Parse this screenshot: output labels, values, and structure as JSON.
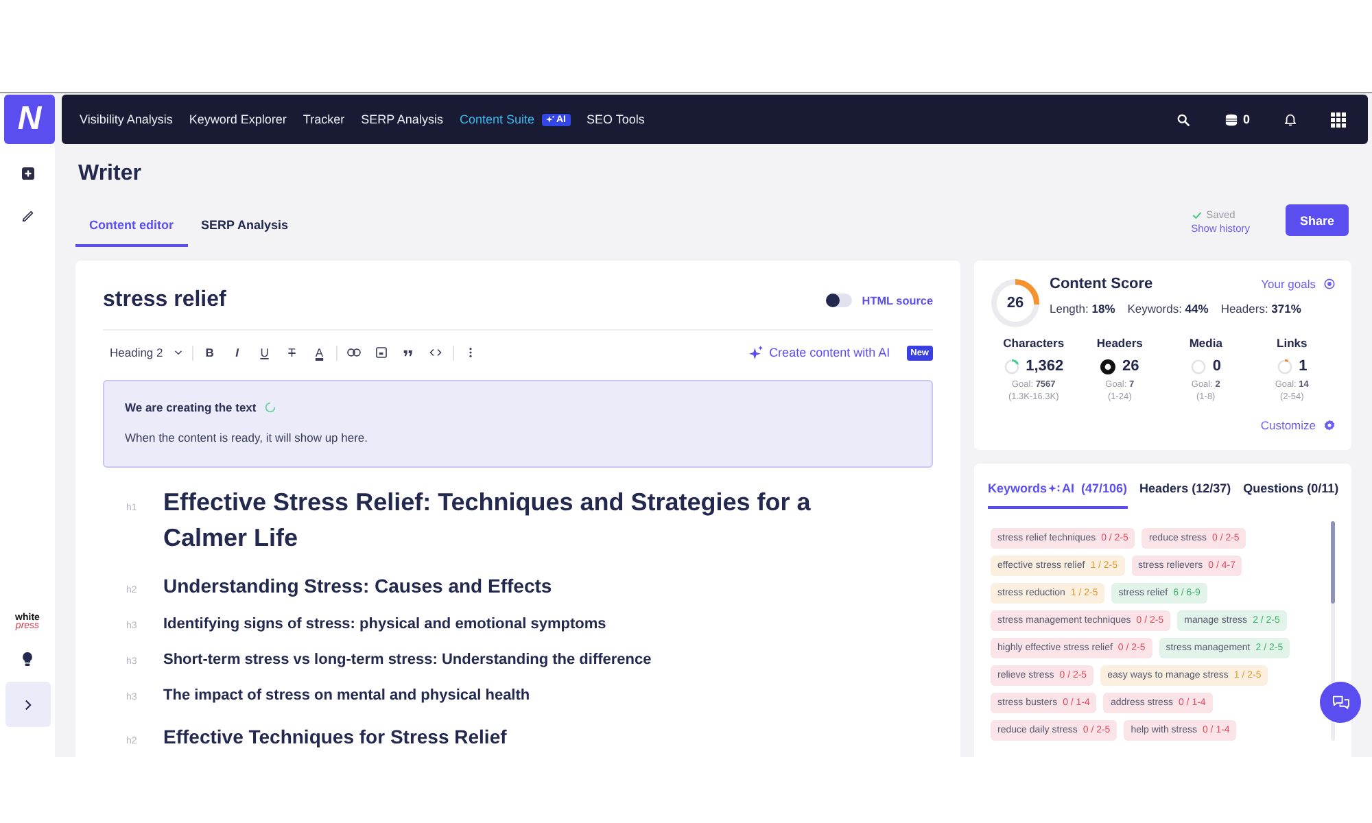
{
  "logo": {
    "text": "N"
  },
  "nav": {
    "items": [
      {
        "label": "Visibility Analysis",
        "selected": false
      },
      {
        "label": "Keyword Explorer",
        "selected": false
      },
      {
        "label": "Tracker",
        "selected": false
      },
      {
        "label": "SERP Analysis",
        "selected": false
      },
      {
        "label": "Content Suite",
        "selected": true,
        "badge": "AI"
      },
      {
        "label": "SEO Tools",
        "selected": false
      }
    ],
    "credits": "0"
  },
  "sidebar": {
    "brand": {
      "line_1": "white",
      "line_2": "press"
    }
  },
  "page": {
    "title": "Writer",
    "tabs": [
      {
        "label": "Content editor",
        "selected": true
      },
      {
        "label": "SERP Analysis",
        "selected": false
      }
    ],
    "save_status": "Saved",
    "history_link": "Show history",
    "share_button": "Share"
  },
  "editor": {
    "title": "stress relief",
    "html_source": {
      "label": "HTML source",
      "on": false
    },
    "toolbar": {
      "block_style": "Heading 2",
      "format_buttons": [
        {
          "kind": "bold",
          "glyph": "B"
        },
        {
          "kind": "italic",
          "glyph": "I"
        },
        {
          "kind": "underline",
          "glyph": "U"
        },
        {
          "kind": "strike",
          "glyph": "T"
        },
        {
          "kind": "color",
          "glyph": "A"
        }
      ],
      "ai_button": "Create content with AI",
      "new_label": "New"
    },
    "notice": {
      "title": "We are creating the text",
      "text": "When the content is ready, it will show up here."
    },
    "outline": [
      {
        "kind": "h1",
        "tag": "h1",
        "text": "Effective Stress Relief: Techniques and Strategies for a Calmer Life"
      },
      {
        "kind": "h2",
        "tag": "h2",
        "text": "Understanding Stress: Causes and Effects"
      },
      {
        "kind": "h3",
        "tag": "h3",
        "text": "Identifying signs of stress: physical and emotional symptoms"
      },
      {
        "kind": "h3",
        "tag": "h3",
        "text": "Short-term stress vs long-term stress: Understanding the difference"
      },
      {
        "kind": "h3",
        "tag": "h3",
        "text": "The impact of stress on mental and physical health"
      },
      {
        "kind": "h2",
        "tag": "h2",
        "text": "Effective Techniques for Stress Relief"
      }
    ]
  },
  "score": {
    "value": "26",
    "level": 0.26,
    "title": "Content Score",
    "goals_link": "Your goals",
    "breakdown": [
      {
        "label": "Length:",
        "value": "18%"
      },
      {
        "label": "Keywords:",
        "value": "44%"
      },
      {
        "label": "Headers:",
        "value": "371%"
      }
    ],
    "metrics": [
      {
        "label": "Characters",
        "value": "1,362",
        "level": 0.18,
        "color": "#3ccf8e",
        "goal": "Goal: **7567**",
        "range": "(1.3K-16.3K)"
      },
      {
        "label": "Headers",
        "value": "26",
        "level": 1,
        "color": "#111111",
        "goal": "Goal: **7**",
        "range": "(1-24)"
      },
      {
        "label": "Media",
        "value": "0",
        "level": 0,
        "goal": "Goal: **2**",
        "range": "(1-8)"
      },
      {
        "label": "Links",
        "value": "1",
        "level": 0.08,
        "color": "#f08a24",
        "goal": "Goal: **14**",
        "range": "(2-54)"
      }
    ],
    "customize_link": "Customize"
  },
  "keywords_panel": {
    "tabs": [
      {
        "label": "Keywords",
        "badge": "AI",
        "count": "(47/106)",
        "selected": true
      },
      {
        "label": "Headers (12/37)",
        "selected": false
      },
      {
        "label": "Questions (0/11)",
        "selected": false
      }
    ],
    "keywords": [
      {
        "phrase": "stress relief techniques",
        "usage": "0 / 2-5",
        "color": "#e5485f"
      },
      {
        "phrase": "reduce stress",
        "usage": "0 / 2-5",
        "color": "#e5485f"
      },
      {
        "phrase": "effective stress relief",
        "usage": "1 / 2-5",
        "color": "#e39a2d"
      },
      {
        "phrase": "stress relievers",
        "usage": "0 / 4-7",
        "color": "#e5485f"
      },
      {
        "phrase": "stress reduction",
        "usage": "1 / 2-5",
        "color": "#e39a2d"
      },
      {
        "phrase": "stress relief",
        "usage": "6 / 6-9",
        "color": "#3bb26a"
      },
      {
        "phrase": "stress management techniques",
        "usage": "0 / 2-5",
        "color": "#e5485f"
      },
      {
        "phrase": "manage stress",
        "usage": "2 / 2-5",
        "color": "#3bb26a"
      },
      {
        "phrase": "highly effective stress relief",
        "usage": "0 / 2-5",
        "color": "#e5485f"
      },
      {
        "phrase": "stress management",
        "usage": "2 / 2-5",
        "color": "#3bb26a"
      },
      {
        "phrase": "relieve stress",
        "usage": "0 / 2-5",
        "color": "#e5485f"
      },
      {
        "phrase": "easy ways to manage stress",
        "usage": "1 / 2-5",
        "color": "#e39a2d"
      },
      {
        "phrase": "stress busters",
        "usage": "0 / 1-4",
        "color": "#e5485f"
      },
      {
        "phrase": "address stress",
        "usage": "0 / 1-4",
        "color": "#e5485f"
      },
      {
        "phrase": "reduce daily stress",
        "usage": "0 / 2-5",
        "color": "#e5485f"
      },
      {
        "phrase": "help with stress",
        "usage": "0 / 1-4",
        "color": "#e5485f"
      }
    ]
  }
}
